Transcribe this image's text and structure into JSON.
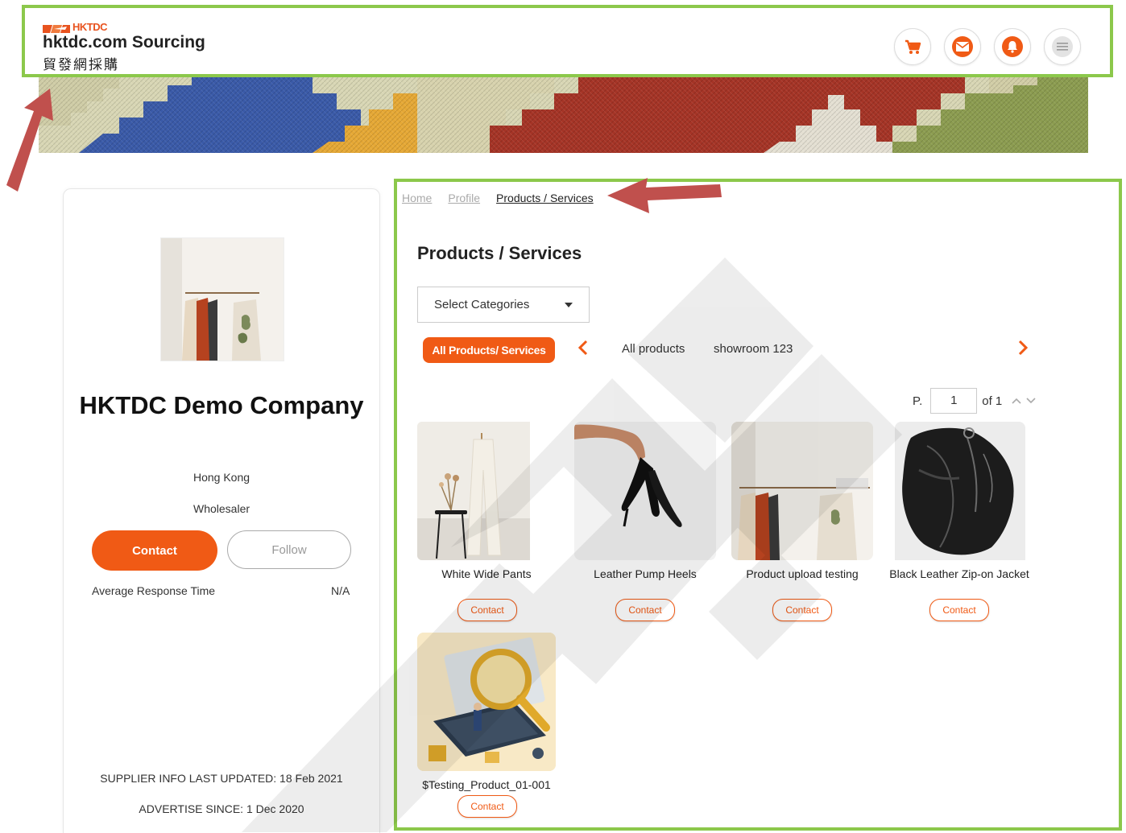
{
  "header": {
    "logo_brand": "HKTDC",
    "logo_title": "hktdc.com Sourcing",
    "logo_chinese": "貿發網採購",
    "icons": [
      "cart-icon",
      "mail-icon",
      "bell-icon",
      "menu-icon"
    ]
  },
  "colors": {
    "accent": "#f05a15",
    "highlight_border": "#8cc84b",
    "annotation_arrow": "#c0504d"
  },
  "supplier": {
    "name": "HKTDC Demo Company",
    "location": "Hong Kong",
    "business_type": "Wholesaler",
    "contact_label": "Contact",
    "follow_label": "Follow",
    "response_time_label": "Average Response Time",
    "response_time_value": "N/A",
    "last_updated": "SUPPLIER INFO LAST UPDATED: 18 Feb 2021",
    "advertise_since": "ADVERTISE SINCE: 1 Dec 2020"
  },
  "breadcrumb": {
    "home": "Home",
    "profile": "Profile",
    "current": "Products / Services"
  },
  "main": {
    "title": "Products / Services",
    "category_select": "Select Categories",
    "tabs": {
      "active": "All Products/ Services",
      "items": [
        "All products",
        "showroom 123"
      ]
    },
    "pager": {
      "prefix": "P.",
      "current": "1",
      "total": "of 1"
    },
    "contact_label": "Contact",
    "products": [
      {
        "name": "White Wide Pants"
      },
      {
        "name": "Leather Pump Heels"
      },
      {
        "name": "Product upload testing"
      },
      {
        "name": "Black Leather Zip-on Jacket"
      },
      {
        "name": "$Testing_Product_01-001"
      }
    ]
  }
}
